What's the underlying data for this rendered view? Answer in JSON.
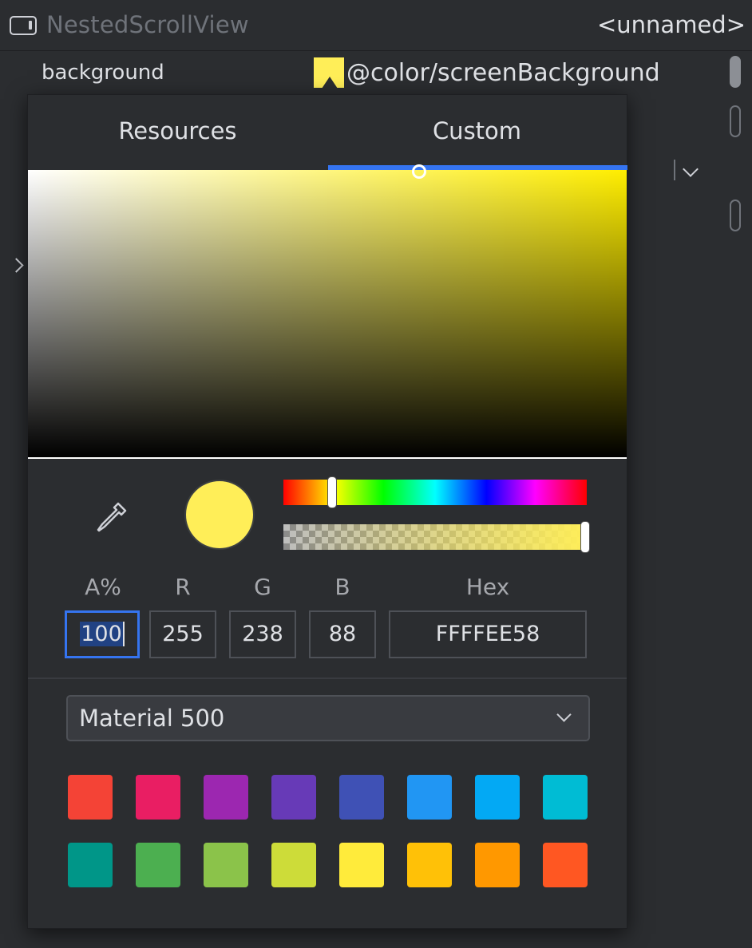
{
  "header": {
    "title": "NestedScrollView",
    "id_label": "<unnamed>"
  },
  "attribute": {
    "name": "background",
    "value": "@color/screenBackground",
    "swatch_color": "#FFEE58"
  },
  "picker": {
    "tabs": [
      {
        "label": "Resources",
        "selected": false
      },
      {
        "label": "Custom",
        "selected": true
      }
    ],
    "preview_color": "#FFEE58",
    "hue_color": "#FFEE00",
    "fields": {
      "alpha": {
        "label": "A%",
        "value": "100"
      },
      "red": {
        "label": "R",
        "value": "255"
      },
      "green": {
        "label": "G",
        "value": "238"
      },
      "blue": {
        "label": "B",
        "value": "88"
      },
      "hex": {
        "label": "Hex",
        "value": "FFFFEE58"
      }
    },
    "palette": {
      "selected": "Material 500",
      "swatches": [
        "#F44336",
        "#E91E63",
        "#9C27B0",
        "#673AB7",
        "#3F51B5",
        "#2196F3",
        "#03A9F4",
        "#00BCD4",
        "#009688",
        "#4CAF50",
        "#8BC34A",
        "#CDDC39",
        "#FFEB3B",
        "#FFC107",
        "#FF9800",
        "#FF5722"
      ]
    }
  },
  "icons": [
    "view-icon",
    "eyedropper-icon",
    "chevron-down-icon",
    "chevron-right-icon"
  ]
}
